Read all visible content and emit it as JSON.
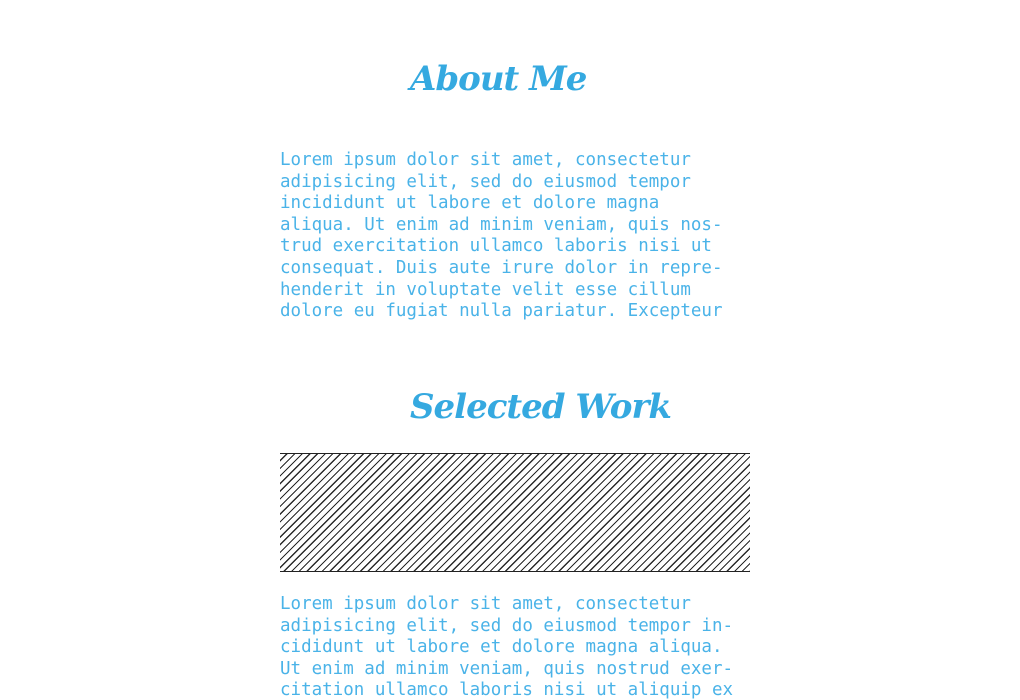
{
  "about": {
    "heading": "About Me",
    "paragraph": "Lorem ipsum dolor sit amet, consectetur\nadipisicing elit, sed do eiusmod tempor\nincididunt ut labore et dolore magna\naliqua. Ut enim ad minim veniam, quis nos-\ntrud exercitation ullamco laboris nisi ut\nconsequat. Duis aute irure dolor in repre-\nhenderit in voluptate velit esse cillum\ndolore eu fugiat nulla pariatur. Excepteur"
  },
  "work": {
    "heading": "Selected Work",
    "paragraph": "Lorem ipsum dolor sit amet, consectetur\nadipisicing elit, sed do eiusmod tempor in-\ncididunt ut labore et dolore magna aliqua.\nUt enim ad minim veniam, quis nostrud exer-\ncitation ullamco laboris nisi ut aliquip ex"
  },
  "colors": {
    "heading": "#35a9e0",
    "text": "#4ab3e8",
    "hatch": "#2a2a2a",
    "background": "#ffffff"
  }
}
